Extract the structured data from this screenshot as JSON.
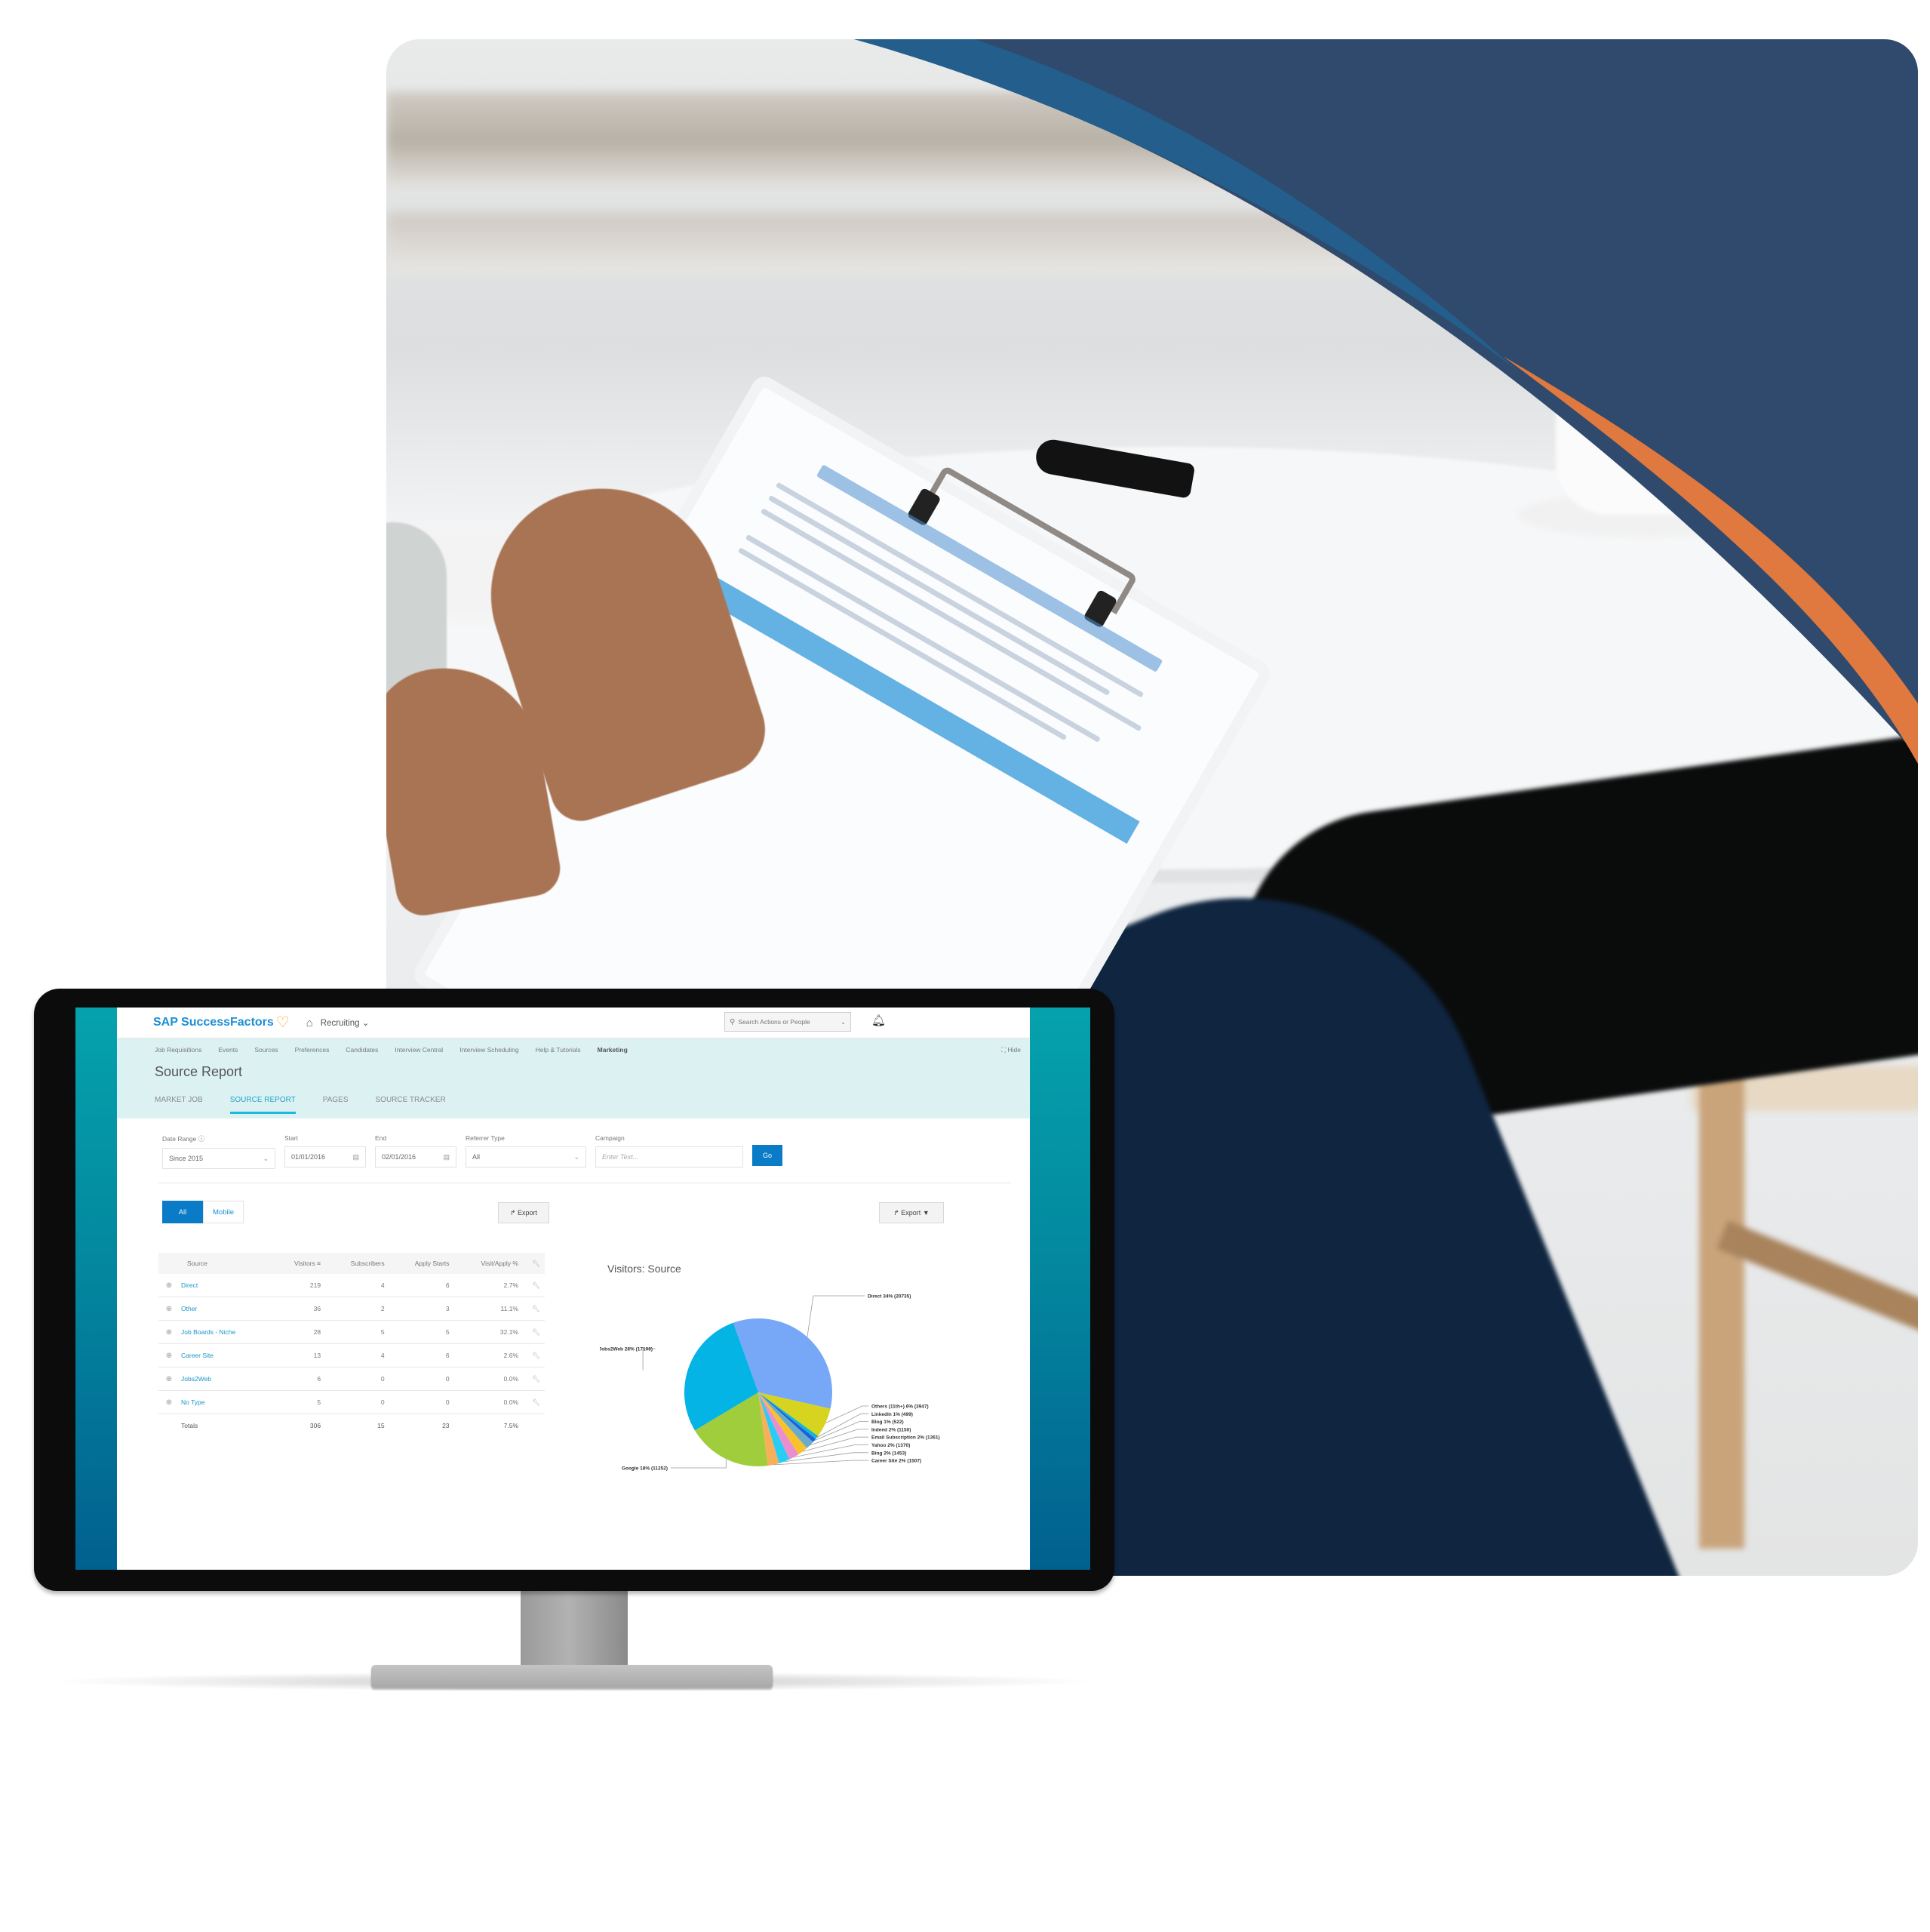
{
  "hero_photo": {
    "description": "Person writing on a clipboard document at a white table, seated beside another person",
    "accent_colors": {
      "navy": "#2f4a6c",
      "blue": "#235e8c",
      "orange": "#e0793f"
    }
  },
  "app": {
    "brand": "SAP SuccessFactors",
    "module": "Recruiting",
    "search_placeholder": "Search Actions or People",
    "nav_items": [
      "Job Requisitions",
      "Events",
      "Sources",
      "Preferences",
      "Candidates",
      "Interview Central",
      "Interview Scheduling",
      "Help & Tutorials",
      "Marketing"
    ],
    "nav_active": "Marketing",
    "hide_label": "Hide",
    "page_title": "Source Report",
    "tabs": [
      {
        "label": "MARKET JOB",
        "active": false
      },
      {
        "label": "SOURCE REPORT",
        "active": true
      },
      {
        "label": "PAGES",
        "active": false
      },
      {
        "label": "SOURCE TRACKER",
        "active": false
      }
    ],
    "filters": {
      "date_range": {
        "label": "Date Range",
        "value": "Since 2015"
      },
      "start": {
        "label": "Start",
        "value": "01/01/2016"
      },
      "end": {
        "label": "End",
        "value": "02/01/2016"
      },
      "referrer_type": {
        "label": "Referrer Type",
        "value": "All"
      },
      "campaign": {
        "label": "Campaign",
        "placeholder": "Enter Text..."
      },
      "go_label": "Go"
    },
    "toggle": {
      "all": "All",
      "mobile": "Mobile",
      "selected": "All"
    },
    "export_label": "Export",
    "export_dropdown_label": "Export",
    "table": {
      "columns": [
        "Source",
        "Visitors",
        "Subscribers",
        "Apply Starts",
        "Visit/Apply %"
      ],
      "rows": [
        {
          "source": "Direct",
          "visitors": "219",
          "subscribers": "4",
          "apply_starts": "6",
          "visit_apply": "2.7%"
        },
        {
          "source": "Other",
          "visitors": "36",
          "subscribers": "2",
          "apply_starts": "3",
          "visit_apply": "11.1%"
        },
        {
          "source": "Job Boards - Niche",
          "visitors": "28",
          "subscribers": "5",
          "apply_starts": "5",
          "visit_apply": "32.1%"
        },
        {
          "source": "Career Site",
          "visitors": "13",
          "subscribers": "4",
          "apply_starts": "6",
          "visit_apply": "2.6%"
        },
        {
          "source": "Jobs2Web",
          "visitors": "6",
          "subscribers": "0",
          "apply_starts": "0",
          "visit_apply": "0.0%"
        },
        {
          "source": "No Type",
          "visitors": "5",
          "subscribers": "0",
          "apply_starts": "0",
          "visit_apply": "0.0%"
        }
      ],
      "totals": {
        "label": "Totals",
        "visitors": "306",
        "subscribers": "15",
        "apply_starts": "23",
        "visit_apply": "7.5%"
      }
    }
  },
  "chart_data": {
    "type": "pie",
    "title": "Visitors: Source",
    "slices": [
      {
        "label": "Direct",
        "percent": 34,
        "value": 20735,
        "color": "#77a7f7"
      },
      {
        "label": "Others (11th+)",
        "percent": 6,
        "value": 3947,
        "color": "#d7d41f"
      },
      {
        "label": "LinkedIn",
        "percent": 1,
        "value": 499,
        "color": "#13b7d4"
      },
      {
        "label": "Blog",
        "percent": 1,
        "value": 522,
        "color": "#1d5fe0"
      },
      {
        "label": "Indeed",
        "percent": 2,
        "value": 1150,
        "color": "#68adc8"
      },
      {
        "label": "Email Subscription",
        "percent": 2,
        "value": 1361,
        "color": "#f9c12b"
      },
      {
        "label": "Yahoo",
        "percent": 2,
        "value": 1370,
        "color": "#ea8ed0"
      },
      {
        "label": "Bing",
        "percent": 2,
        "value": 1453,
        "color": "#29cdf3"
      },
      {
        "label": "Career Site",
        "percent": 2,
        "value": 1507,
        "color": "#f7b05a"
      },
      {
        "label": "Google",
        "percent": 18,
        "value": 11252,
        "color": "#a0cd3c"
      },
      {
        "label": "Jobs2Web",
        "percent": 28,
        "value": 17108,
        "color": "#03b4e4"
      }
    ],
    "legend": "callout-labels"
  }
}
